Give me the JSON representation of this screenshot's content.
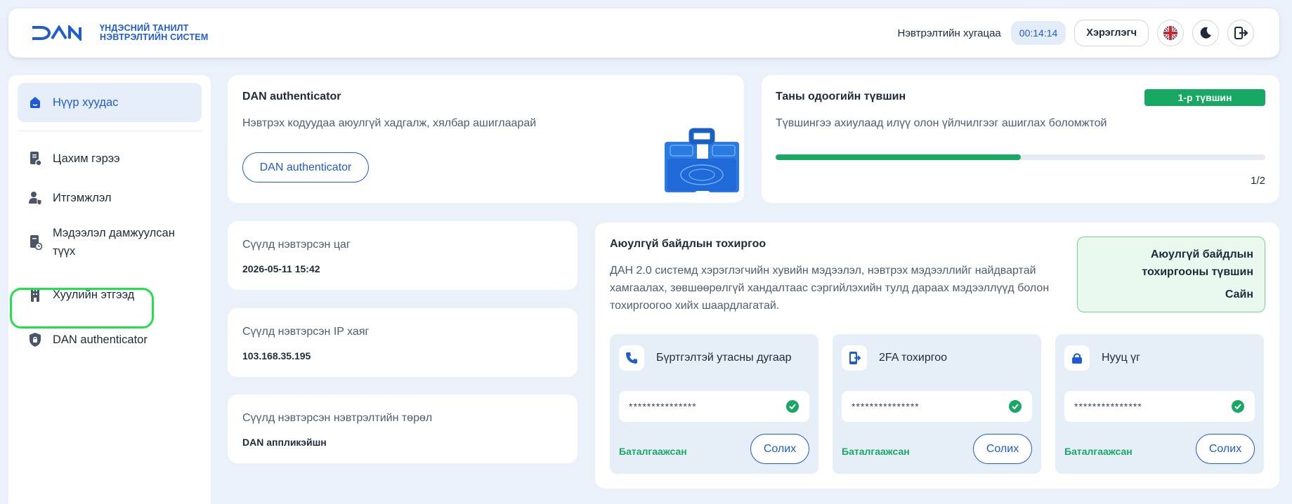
{
  "header": {
    "logo_text": "DAN",
    "brand_line1": "ҮНДЭСНИЙ ТАНИЛТ",
    "brand_line2": "НЭВТРЭЛТИЙН СИСТЕМ",
    "session_label": "Нэвтрэлтийн хугацаа",
    "timer": "00:14:14",
    "user_button": "Хэрэглэгч"
  },
  "sidebar": {
    "items": [
      {
        "label": "Нүүр хуудас"
      },
      {
        "label": "Цахим гэрээ"
      },
      {
        "label": "Итгэмжлэл"
      },
      {
        "label": "Мэдээлэл дамжуулсан түүх"
      },
      {
        "label": "Хуулийн этгээд"
      },
      {
        "label": "DAN authenticator"
      }
    ]
  },
  "authenticator_card": {
    "title": "DAN authenticator",
    "subtitle": "Нэвтрэх кодуудаа аюулгүй хадгалж, хялбар ашиглаарай",
    "button": "DAN authenticator"
  },
  "level_card": {
    "title": "Таны одоогийн түвшин",
    "badge": "1-р түвшин",
    "subtitle": "Түвшингээ ахиулаад илүү олон үйлчилгээг ашиглах боломжтой",
    "progress_fraction": 0.5,
    "progress_text": "1/2"
  },
  "last_login": {
    "time_label": "Сүүлд нэвтэрсэн цаг",
    "time_value": "2026-05-11 15:42",
    "ip_label": "Сүүлд нэвтэрсэн IP хаяг",
    "ip_value": "103.168.35.195",
    "type_label": "Сүүлд нэвтэрсэн нэвтрэлтийн төрөл",
    "type_value": "DAN аппликэйшн"
  },
  "security": {
    "title": "Аюулгүй байдлын тохиргоо",
    "description": "ДАН 2.0 системд хэрэглэгчийн хувийн мэдээлэл, нэвтрэх мэдээллийг найдвартай хамгаалах, зөвшөөрөлгүй хандалтаас сэргийлэхийн тулд дараах мэдээллүүд болон тохиргоогоо хийх шаардлагатай.",
    "status_title": "Аюулгүй байдлын тохиргооны түвшин",
    "status_value": "Сайн",
    "items": [
      {
        "title": "Бүртгэлтэй утасны дугаар",
        "masked": "***************",
        "verified": "Баталгаажсан",
        "button": "Солих",
        "icon": "phone-icon"
      },
      {
        "title": "2FA тохиргоо",
        "masked": "***************",
        "verified": "Баталгаажсан",
        "button": "Солих",
        "icon": "device-2fa-icon"
      },
      {
        "title": "Нууц үг",
        "masked": "***************",
        "verified": "Баталгаажсан",
        "button": "Солих",
        "icon": "lock-icon"
      }
    ]
  },
  "colors": {
    "accent": "#1f5bd6",
    "success": "#17a964",
    "background": "#eaf1fa"
  }
}
